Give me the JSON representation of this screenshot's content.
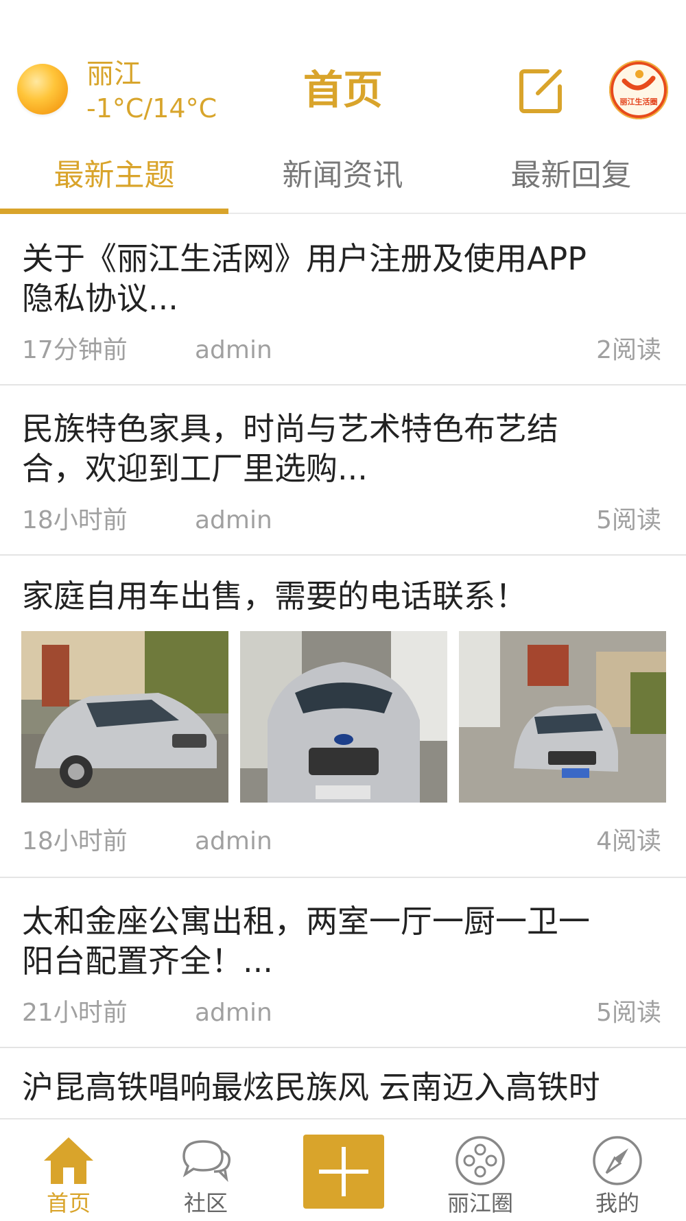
{
  "header": {
    "weather_city": "丽江",
    "weather_temp": "-1°C/14°C",
    "title": "首页",
    "logo_text": "丽江生活圈"
  },
  "tabs": [
    {
      "label": "最新主题",
      "active": true
    },
    {
      "label": "新闻资讯",
      "active": false
    },
    {
      "label": "最新回复",
      "active": false
    }
  ],
  "posts": [
    {
      "title_line1": "关于《丽江生活网》用户注册及使用APP",
      "title_line2": "隐私协议...",
      "time": "17分钟前",
      "author": "admin",
      "reads": "2阅读"
    },
    {
      "title_line1": "民族特色家具，时尚与艺术特色布艺结",
      "title_line2": "合，欢迎到工厂里选购...",
      "time": "18小时前",
      "author": "admin",
      "reads": "5阅读"
    },
    {
      "title_line1": "家庭自用车出售，需要的电话联系！",
      "time": "18小时前",
      "author": "admin",
      "reads": "4阅读",
      "photos": [
        "car-photo-1",
        "car-photo-2",
        "car-photo-3"
      ]
    },
    {
      "title_line1": "太和金座公寓出租，两室一厅一厨一卫一",
      "title_line2": "阳台配置齐全！...",
      "time": "21小时前",
      "author": "admin",
      "reads": "5阅读"
    },
    {
      "title_line1": "沪昆高铁唱响最炫民族风 云南迈入高铁时"
    }
  ],
  "bottom_nav": [
    {
      "label": "首页",
      "icon": "home-icon",
      "active": true
    },
    {
      "label": "社区",
      "icon": "chat-bubbles-icon",
      "active": false
    },
    {
      "label": "",
      "icon": "plus-icon",
      "active": false
    },
    {
      "label": "丽江圈",
      "icon": "circle-dots-icon",
      "active": false
    },
    {
      "label": "我的",
      "icon": "compass-icon",
      "active": false
    }
  ],
  "colors": {
    "accent": "#d9a42b",
    "text": "#222222",
    "meta": "#a0a0a0"
  }
}
